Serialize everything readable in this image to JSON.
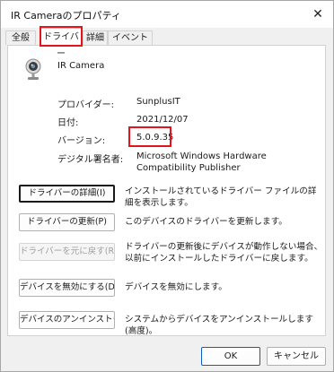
{
  "window": {
    "title": "IR Cameraのプロパティ",
    "close_glyph": "✕"
  },
  "tabs": [
    {
      "label": "全般",
      "active": false
    },
    {
      "label": "ドライバー",
      "active": true
    },
    {
      "label": "詳細",
      "active": false
    },
    {
      "label": "イベント",
      "active": false
    }
  ],
  "device": {
    "name": "IR Camera",
    "icon": "webcam-icon"
  },
  "info": {
    "provider_label": "プロバイダー:",
    "provider_value": "SunplusIT",
    "date_label": "日付:",
    "date_value": "2021/12/07",
    "version_label": "バージョン:",
    "version_value": "5.0.9.35",
    "signer_label": "デジタル署名者:",
    "signer_value": "Microsoft Windows Hardware Compatibility Publisher"
  },
  "actions": {
    "details_button": "ドライバーの詳細(I)",
    "details_desc": "インストールされているドライバー ファイルの詳細を表示します。",
    "update_button": "ドライバーの更新(P)",
    "update_desc": "このデバイスのドライバーを更新します。",
    "rollback_button": "ドライバーを元に戻す(R)",
    "rollback_desc": "ドライバーの更新後にデバイスが動作しない場合、以前にインストールしたドライバーに戻します。",
    "disable_button": "デバイスを無効にする(D)",
    "disable_desc": "デバイスを無効にします。",
    "uninstall_button": "デバイスのアンインストール(U)",
    "uninstall_desc": "システムからデバイスをアンインストールします (高度)。"
  },
  "footer": {
    "ok": "OK",
    "cancel": "キャンセル"
  },
  "colors": {
    "highlight": "#e3151a",
    "ok_border": "#0f5cc4"
  }
}
